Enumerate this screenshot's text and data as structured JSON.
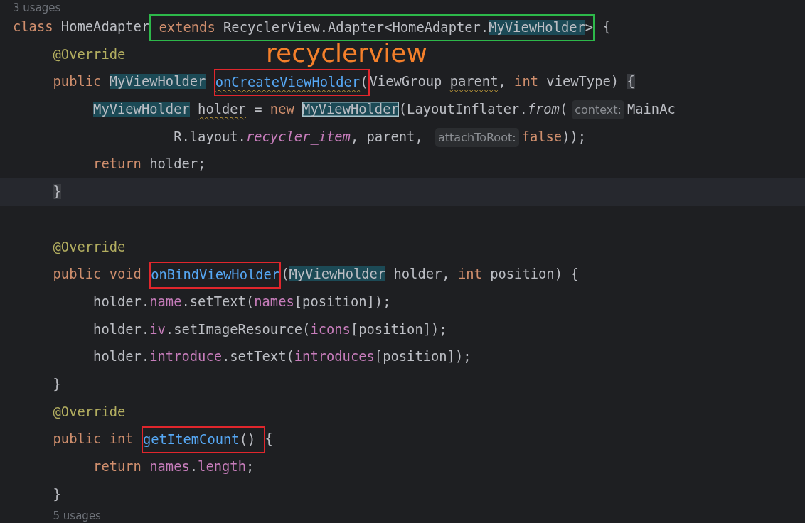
{
  "callout": "recyclerview",
  "lines": [
    {
      "kind": "usages",
      "text": "3 usages"
    },
    {
      "kind": "code",
      "tokens": [
        {
          "kind": "keyword",
          "text": "class "
        },
        {
          "kind": "plain",
          "text": "HomeAdapter"
        },
        {
          "kind": "frame",
          "color": "#2db84a",
          "tokens": [
            {
              "kind": "keyword",
              "text": " extends "
            },
            {
              "kind": "plain",
              "text": "RecyclerView.Adapter<HomeAdapter."
            },
            {
              "kind": "plain",
              "text": "MyViewHolder",
              "highlighted": true
            },
            {
              "kind": "plain",
              "text": ">"
            }
          ]
        },
        {
          "kind": "plain",
          "text": " {"
        }
      ]
    },
    {
      "kind": "code",
      "tokens": [
        {
          "kind": "annotation",
          "text": "     @Override"
        }
      ]
    },
    {
      "kind": "code",
      "tokens": [
        {
          "kind": "keyword",
          "text": "     public "
        },
        {
          "kind": "plain",
          "text": "MyViewHolder ",
          "highlighted": true
        },
        {
          "kind": "frame",
          "color": "#e0262c",
          "tokens": [
            {
              "kind": "method",
              "text": "onCreateViewHolder",
              "warning": true
            },
            {
              "kind": "plain",
              "text": "("
            }
          ]
        },
        {
          "kind": "plain",
          "text": "ViewGroup "
        },
        {
          "kind": "plain",
          "text": "parent",
          "warning": true
        },
        {
          "kind": "plain",
          "text": ", "
        },
        {
          "kind": "keyword",
          "text": "int "
        },
        {
          "kind": "plain",
          "text": "viewType) "
        },
        {
          "kind": "plain",
          "text": "{",
          "highlighted": true,
          "muted": true
        }
      ]
    },
    {
      "kind": "code",
      "tokens": [
        {
          "kind": "plain",
          "text": "          MyViewHolder ",
          "highlighted": true
        },
        {
          "kind": "plain",
          "text": "holder",
          "warning": true
        },
        {
          "kind": "plain",
          "text": " = "
        },
        {
          "kind": "keyword",
          "text": "new "
        },
        {
          "kind": "plain",
          "text": "MyViewHolder",
          "highlighted": true,
          "outlined": true
        },
        {
          "kind": "plain",
          "text": "(LayoutInflater."
        },
        {
          "kind": "static",
          "text": "from"
        },
        {
          "kind": "plain",
          "text": "("
        },
        {
          "kind": "hint",
          "text": "context:"
        },
        {
          "kind": "plain",
          "text": "MainAc"
        }
      ]
    },
    {
      "kind": "code",
      "tokens": [
        {
          "kind": "plain",
          "text": "                    R.layout."
        },
        {
          "kind": "constant",
          "text": "recycler_item"
        },
        {
          "kind": "plain",
          "text": ", parent, "
        },
        {
          "kind": "hint",
          "text": "attachToRoot:"
        },
        {
          "kind": "keyword",
          "text": "false"
        },
        {
          "kind": "plain",
          "text": "));"
        }
      ]
    },
    {
      "kind": "code",
      "tokens": [
        {
          "kind": "keyword",
          "text": "          return "
        },
        {
          "kind": "plain",
          "text": "holder;"
        }
      ]
    },
    {
      "kind": "code",
      "current": true,
      "tokens": [
        {
          "kind": "plain",
          "text": "     }",
          "highlighted": true,
          "muted": true
        }
      ]
    },
    {
      "kind": "code"
    },
    {
      "kind": "code",
      "tokens": [
        {
          "kind": "annotation",
          "text": "     @Override"
        }
      ]
    },
    {
      "kind": "code",
      "tokens": [
        {
          "kind": "keyword",
          "text": "     public void "
        },
        {
          "kind": "frame",
          "color": "#e0262c",
          "tokens": [
            {
              "kind": "method",
              "text": "onBindViewHolder"
            }
          ]
        },
        {
          "kind": "plain",
          "text": "("
        },
        {
          "kind": "plain",
          "text": "MyViewHolder",
          "highlighted": true
        },
        {
          "kind": "plain",
          "text": " holder, "
        },
        {
          "kind": "keyword",
          "text": "int "
        },
        {
          "kind": "plain",
          "text": "position) {"
        }
      ]
    },
    {
      "kind": "code",
      "tokens": [
        {
          "kind": "plain",
          "text": "          holder."
        },
        {
          "kind": "field",
          "text": "name"
        },
        {
          "kind": "plain",
          "text": ".setText("
        },
        {
          "kind": "field",
          "text": "names"
        },
        {
          "kind": "plain",
          "text": "[position]);"
        }
      ]
    },
    {
      "kind": "code",
      "tokens": [
        {
          "kind": "plain",
          "text": "          holder."
        },
        {
          "kind": "field",
          "text": "iv"
        },
        {
          "kind": "plain",
          "text": ".setImageResource("
        },
        {
          "kind": "field",
          "text": "icons"
        },
        {
          "kind": "plain",
          "text": "[position]);"
        }
      ]
    },
    {
      "kind": "code",
      "tokens": [
        {
          "kind": "plain",
          "text": "          holder."
        },
        {
          "kind": "field",
          "text": "introduce"
        },
        {
          "kind": "plain",
          "text": ".setText("
        },
        {
          "kind": "field",
          "text": "introduces"
        },
        {
          "kind": "plain",
          "text": "[position]);"
        }
      ]
    },
    {
      "kind": "code",
      "tokens": [
        {
          "kind": "plain",
          "text": "     }"
        }
      ]
    },
    {
      "kind": "code",
      "tokens": [
        {
          "kind": "annotation",
          "text": "     @Override"
        }
      ]
    },
    {
      "kind": "code",
      "tokens": [
        {
          "kind": "keyword",
          "text": "     public int "
        },
        {
          "kind": "frame",
          "color": "#e0262c",
          "tokens": [
            {
              "kind": "method",
              "text": "getItemCount"
            },
            {
              "kind": "plain",
              "text": "() "
            }
          ]
        },
        {
          "kind": "plain",
          "text": "{"
        }
      ]
    },
    {
      "kind": "code",
      "tokens": [
        {
          "kind": "keyword",
          "text": "          return "
        },
        {
          "kind": "field",
          "text": "names"
        },
        {
          "kind": "plain",
          "text": "."
        },
        {
          "kind": "field",
          "text": "length"
        },
        {
          "kind": "plain",
          "text": ";"
        }
      ]
    },
    {
      "kind": "code",
      "tokens": [
        {
          "kind": "plain",
          "text": "     }"
        }
      ]
    },
    {
      "kind": "usages",
      "text": "     5 usages"
    }
  ]
}
